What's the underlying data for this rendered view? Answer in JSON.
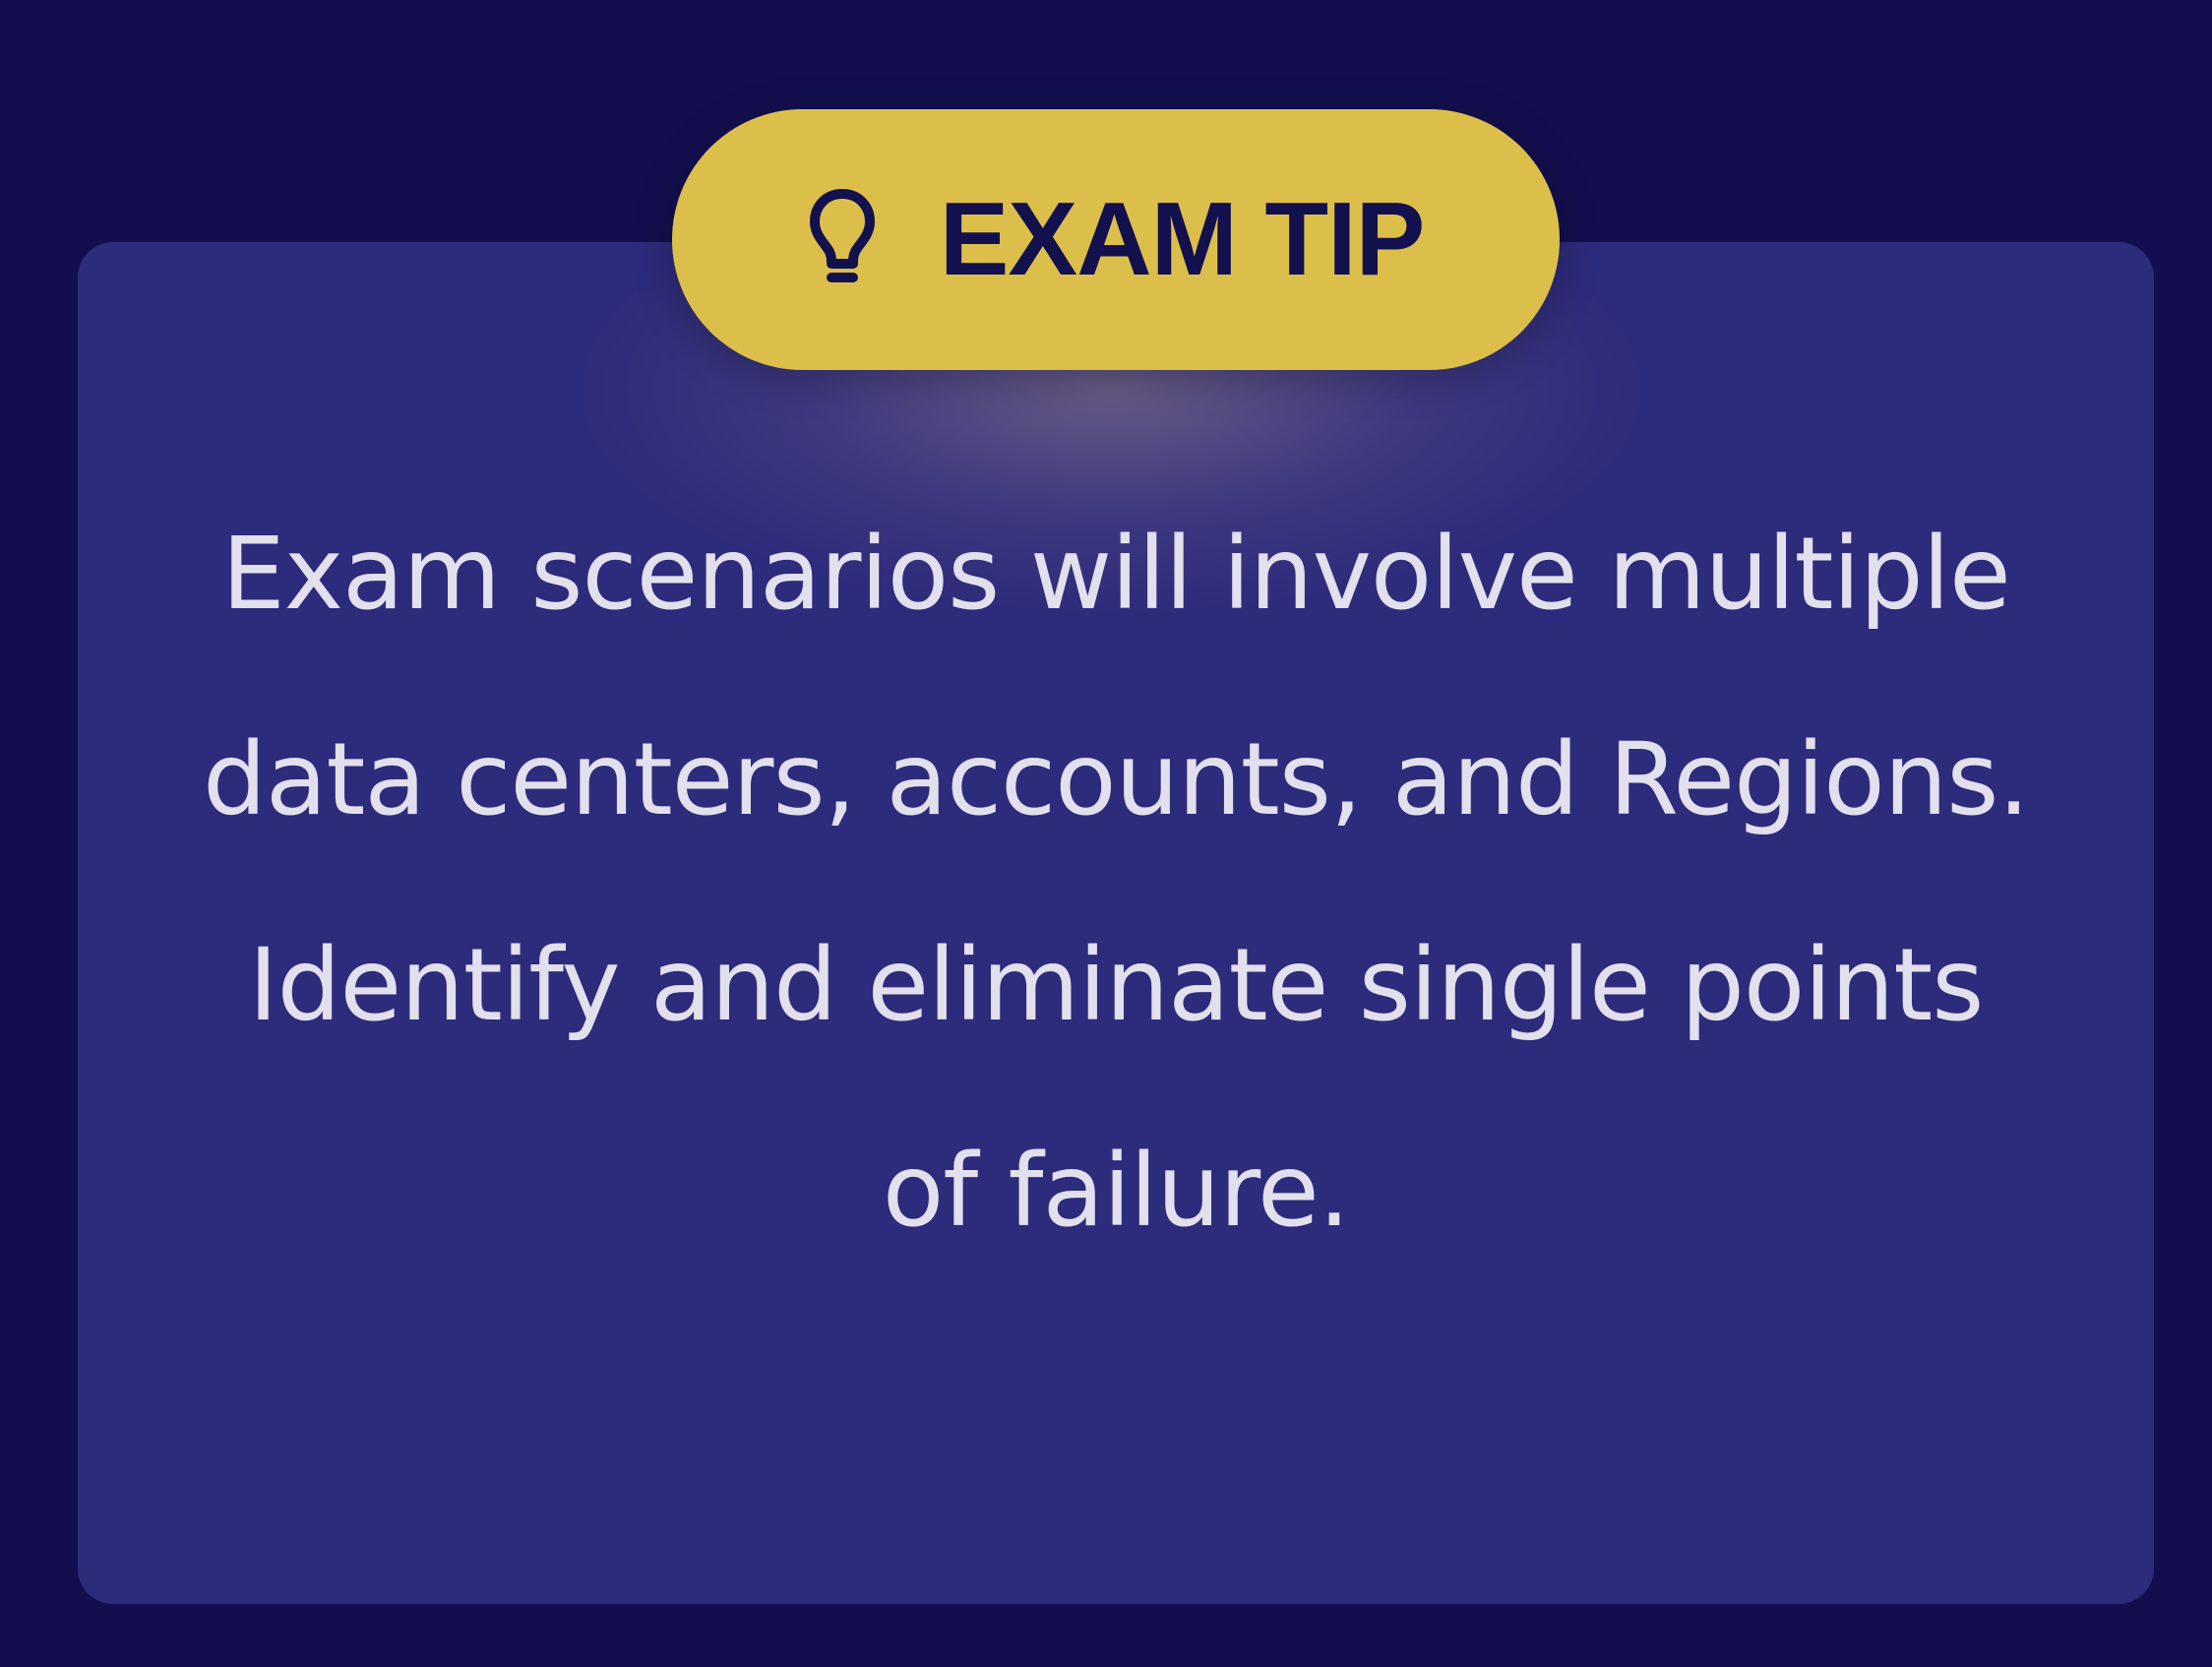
{
  "badge": {
    "icon": "lightbulb-icon",
    "label": "EXAM TIP",
    "background_color": "#dcbf4b",
    "text_color": "#13104e"
  },
  "tip": {
    "body": "Exam scenarios will involve multiple data centers, accounts, and Regions. Identify and eliminate single points of failure."
  },
  "colors": {
    "page_background": "#130f4f",
    "card_background": "#2d2b7b",
    "body_text": "#e2e0ec"
  }
}
